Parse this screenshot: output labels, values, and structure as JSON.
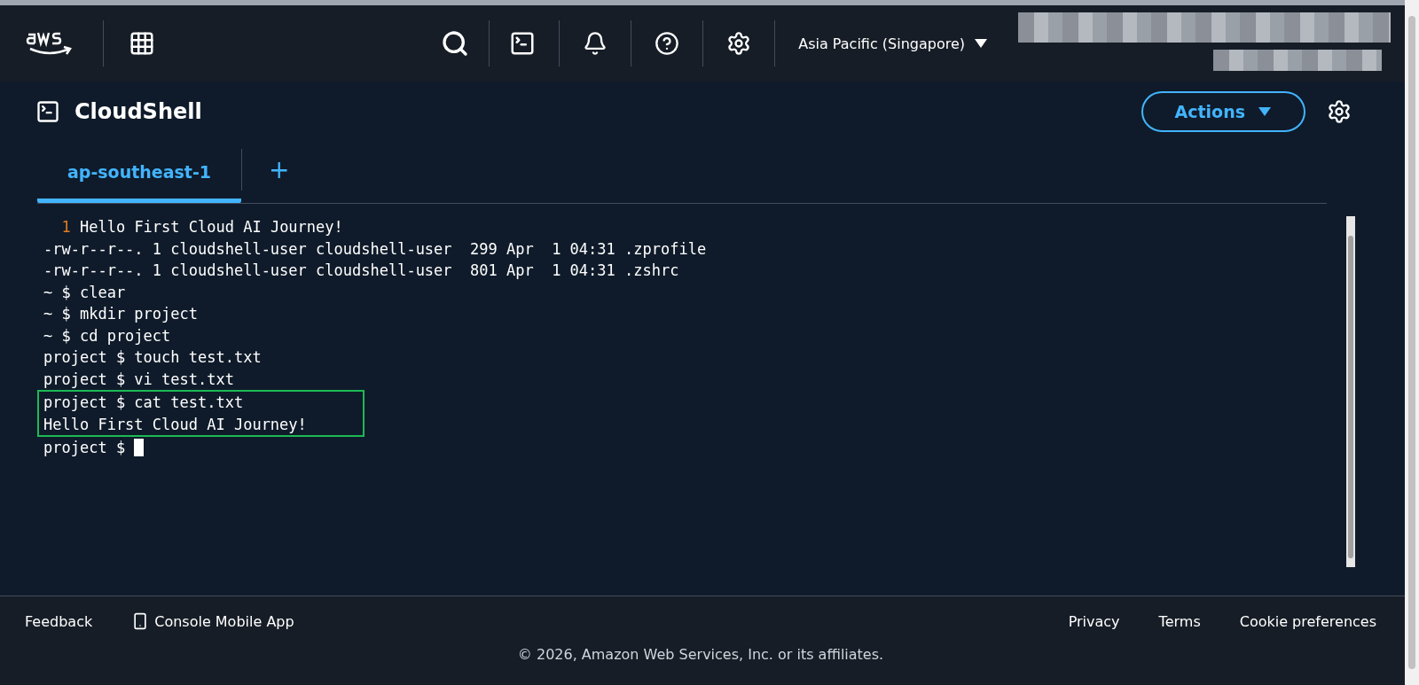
{
  "top_nav": {
    "region": "Asia Pacific (Singapore)"
  },
  "header": {
    "title": "CloudShell",
    "actions_button": "Actions"
  },
  "tabs": [
    {
      "label": "ap-southeast-1",
      "selected": true
    }
  ],
  "add_tab": "+",
  "terminal": {
    "lines": [
      {
        "kind": "numbered",
        "number": "1",
        "text": "Hello First Cloud AI Journey!",
        "highlighted": false
      },
      {
        "kind": "output",
        "text": "-rw-r--r--. 1 cloudshell-user cloudshell-user  299 Apr  1 04:31 .zprofile",
        "highlighted": false
      },
      {
        "kind": "output",
        "text": "-rw-r--r--. 1 cloudshell-user cloudshell-user  801 Apr  1 04:31 .zshrc",
        "highlighted": false
      },
      {
        "kind": "output",
        "text": "~ $ clear",
        "highlighted": false
      },
      {
        "kind": "output",
        "text": "~ $ mkdir project",
        "highlighted": false
      },
      {
        "kind": "output",
        "text": "~ $ cd project",
        "highlighted": false
      },
      {
        "kind": "output",
        "text": "project $ touch test.txt",
        "highlighted": false
      },
      {
        "kind": "output",
        "text": "project $ vi test.txt",
        "highlighted": false
      },
      {
        "kind": "output",
        "text": "project $ cat test.txt",
        "highlighted": true
      },
      {
        "kind": "output",
        "text": "Hello First Cloud AI Journey!",
        "highlighted": true
      },
      {
        "kind": "prompt",
        "text": "project $ ",
        "highlighted": false
      }
    ]
  },
  "footer": {
    "left": [
      {
        "label": "Feedback",
        "kind": "link"
      },
      {
        "label": "Console Mobile App",
        "kind": "app"
      }
    ],
    "right": [
      "Privacy",
      "Terms",
      "Cookie preferences"
    ],
    "copyright": "© 2026, Amazon Web Services, Inc. or its affiliates."
  }
}
